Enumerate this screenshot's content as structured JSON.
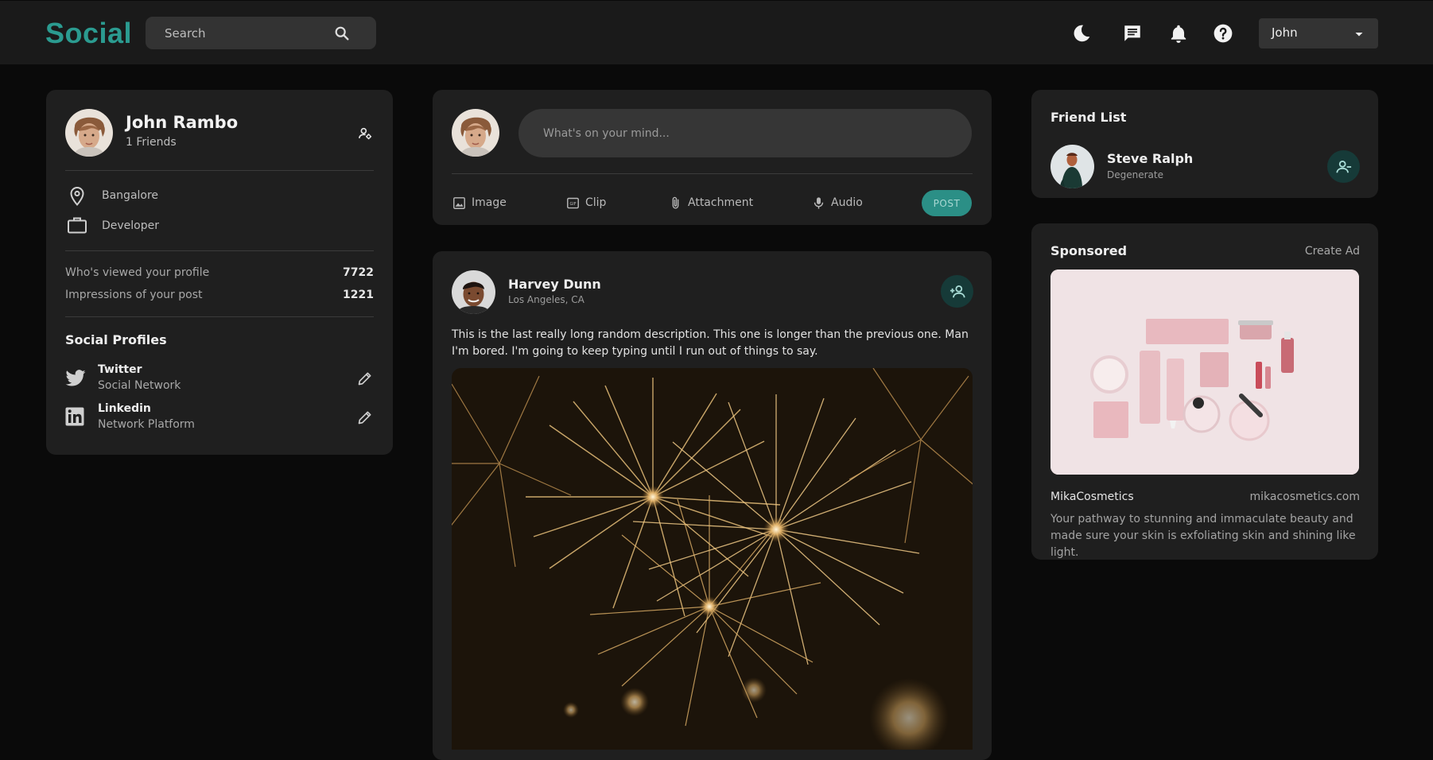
{
  "header": {
    "logo": "Social",
    "search_placeholder": "Search",
    "user_name": "John"
  },
  "profile": {
    "name": "John Rambo",
    "friends": "1 Friends",
    "location": "Bangalore",
    "occupation": "Developer",
    "viewed_label": "Who's viewed your profile",
    "viewed_value": "7722",
    "impressions_label": "Impressions of your post",
    "impressions_value": "1221",
    "social_heading": "Social Profiles",
    "socials": [
      {
        "name": "Twitter",
        "type": "Social Network"
      },
      {
        "name": "Linkedin",
        "type": "Network Platform"
      }
    ]
  },
  "composer": {
    "placeholder": "What's on your mind...",
    "tools": [
      "Image",
      "Clip",
      "Attachment",
      "Audio"
    ],
    "post_label": "POST"
  },
  "post": {
    "author": "Harvey Dunn",
    "location": "Los Angeles, CA",
    "description": "This is the last really long random description. This one is longer than the previous one. Man I'm bored. I'm going to keep typing until I run out of things to say."
  },
  "friends": {
    "heading": "Friend List",
    "items": [
      {
        "name": "Steve Ralph",
        "subtitle": "Degenerate"
      }
    ]
  },
  "sponsored": {
    "heading": "Sponsored",
    "create_ad": "Create Ad",
    "brand": "MikaCosmetics",
    "url": "mikacosmetics.com",
    "text": "Your pathway to stunning and immaculate beauty and made sure your skin is exfoliating skin and shining like light."
  },
  "colors": {
    "accent": "#2b9b90",
    "background": "#0a0a0a",
    "card": "#1f1f1f",
    "topbar": "#1a1a1a"
  }
}
